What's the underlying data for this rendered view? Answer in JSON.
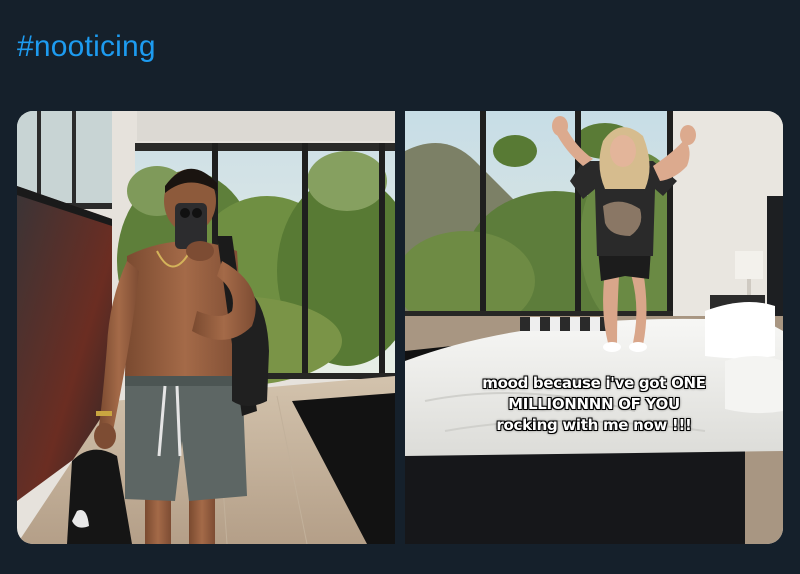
{
  "post": {
    "hashtag": "#nooticing"
  },
  "media": [
    {
      "icon": "photo-left-man-mirror-selfie",
      "caption_lines": []
    },
    {
      "icon": "photo-right-woman-jumping-on-bed",
      "caption_lines": [
        "mood because i've got ONE",
        "MILLIONNNN OF YOU",
        "rocking with me now !!!"
      ]
    }
  ],
  "colors": {
    "background": "#15202b",
    "hashtag": "#1d9bf0"
  }
}
